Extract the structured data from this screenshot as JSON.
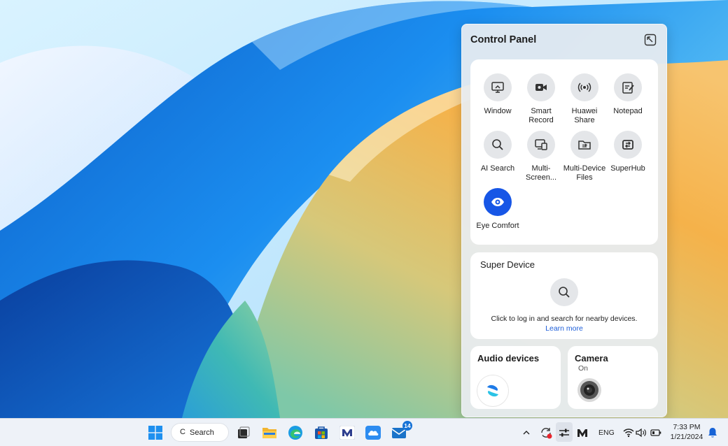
{
  "panel": {
    "title": "Control Panel",
    "pin_icon": "collapse-panel-icon",
    "quick_tiles": [
      {
        "label": "Window",
        "icon": "window-cast-icon",
        "active": false
      },
      {
        "label": "Smart Record",
        "icon": "video-record-icon",
        "active": false
      },
      {
        "label": "Huawei Share",
        "icon": "wireless-share-icon",
        "active": false
      },
      {
        "label": "Notepad",
        "icon": "notepad-icon",
        "active": false
      },
      {
        "label": "AI Search",
        "icon": "search-icon",
        "active": false
      },
      {
        "label": "Multi-Screen...",
        "icon": "multi-screen-icon",
        "active": false
      },
      {
        "label": "Multi-Device Files",
        "icon": "folder-share-icon",
        "active": false
      },
      {
        "label": "SuperHub",
        "icon": "superhub-icon",
        "active": true
      },
      {
        "label": "Eye Comfort",
        "icon": "eye-icon",
        "active": true
      }
    ],
    "super_device": {
      "title": "Super Device",
      "description": "Click to log in and search for nearby devices.",
      "link": "Learn more"
    },
    "audio": {
      "title": "Audio devices",
      "icon": "audio-app-icon"
    },
    "camera": {
      "title": "Camera",
      "status": "On",
      "icon": "camera-lens-icon"
    }
  },
  "taskbar": {
    "search_label": "Search",
    "search_glyph": "C",
    "apps": [
      {
        "name": "start-button",
        "icon": "windows-logo-icon"
      },
      {
        "name": "task-view-button",
        "icon": "task-view-icon"
      },
      {
        "name": "file-explorer-button",
        "icon": "folder-icon"
      },
      {
        "name": "edge-button",
        "icon": "edge-browser-icon"
      },
      {
        "name": "store-button",
        "icon": "store-icon"
      },
      {
        "name": "pc-manager-button",
        "icon": "pc-manager-icon"
      },
      {
        "name": "cloud-button",
        "icon": "cloud-icon"
      },
      {
        "name": "mail-button",
        "icon": "mail-icon",
        "badge": "14"
      }
    ],
    "tray": {
      "language": "ENG",
      "time": "7:33 PM",
      "date": "1/21/2024"
    }
  },
  "colors": {
    "accent": "#1756e6",
    "link": "#1f5fd9",
    "panel_bg": "#e8ecf0"
  }
}
